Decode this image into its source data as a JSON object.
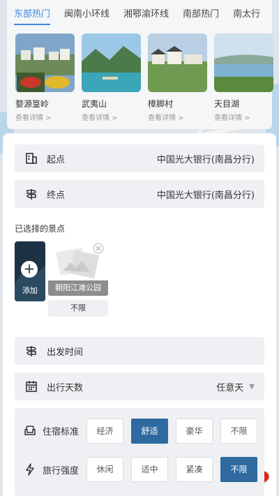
{
  "tabs": [
    "东部热门",
    "闽南小环线",
    "湘鄂渝环线",
    "南部热门",
    "南太行"
  ],
  "active_tab_index": 0,
  "cards": [
    {
      "name": "婺源篁岭",
      "more": "查看详情 >"
    },
    {
      "name": "武夷山",
      "more": "查看详情 >"
    },
    {
      "name": "樟脚村",
      "more": "查看详情 >"
    },
    {
      "name": "天目湖",
      "more": "查看详情 >"
    }
  ],
  "start": {
    "label": "起点",
    "value": "中国光大银行(南昌分行)"
  },
  "end": {
    "label": "终点",
    "value": "中国光大银行(南昌分行)"
  },
  "selected_spots": {
    "title": "已选择的景点",
    "add_label": "添加"
  },
  "spot": {
    "name": "朝阳江滩公园",
    "limit": "不限"
  },
  "departure": {
    "label": "出发时间"
  },
  "days": {
    "label": "出行天数",
    "value": "任意天"
  },
  "accommodation": {
    "label": "住宿标准",
    "options": [
      "经济",
      "舒适",
      "豪华",
      "不限"
    ],
    "selected": 1
  },
  "intensity": {
    "label": "旅行强度",
    "options": [
      "休闲",
      "适中",
      "紧凑",
      "不限"
    ],
    "selected": 3
  },
  "colors": {
    "accent": "#3a8be0",
    "selected": "#2e6aa0",
    "redaction": "#e2231a"
  }
}
